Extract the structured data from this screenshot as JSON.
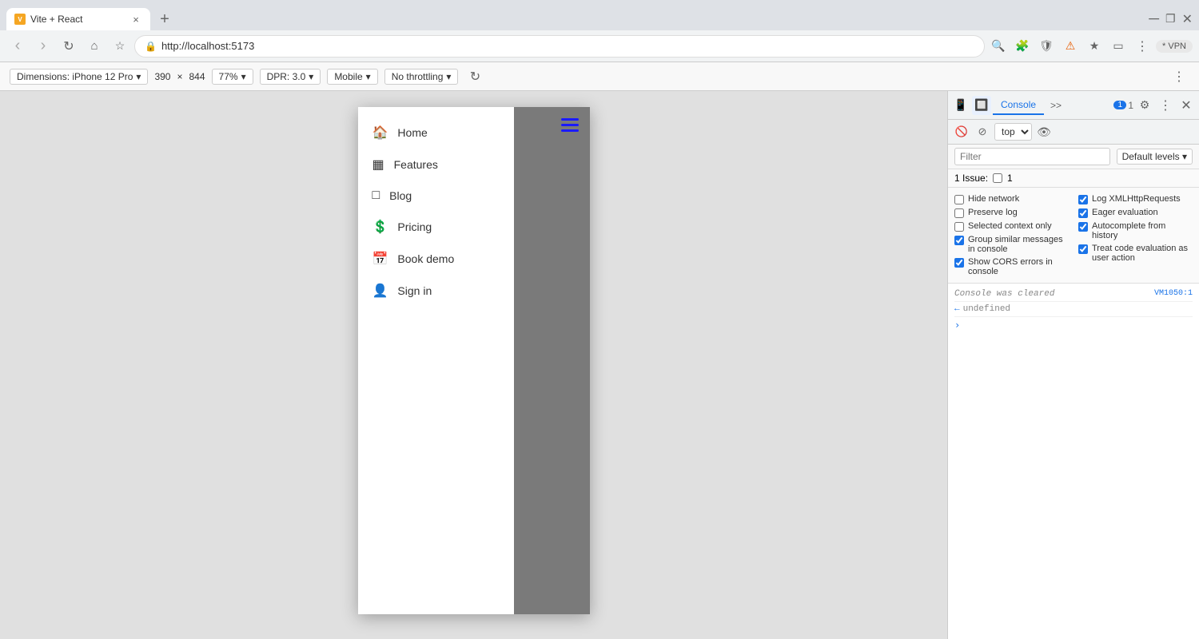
{
  "browser": {
    "tab": {
      "favicon_text": "V",
      "title": "Vite + React"
    },
    "url": "http://localhost:5173",
    "nav_buttons": {
      "back": "‹",
      "forward": "›",
      "reload": "↻",
      "home": "⌂",
      "bookmark": "☆"
    }
  },
  "device_toolbar": {
    "dimensions_label": "Dimensions: iPhone 12 Pro",
    "width": "390",
    "x_label": "×",
    "height": "844",
    "zoom_label": "77%",
    "dpr_label": "DPR: 3.0",
    "mode_label": "Mobile",
    "throttle_label": "No throttling",
    "rotate_icon": "↻"
  },
  "mobile_nav": {
    "items": [
      {
        "id": "home",
        "icon": "🏠",
        "label": "Home"
      },
      {
        "id": "features",
        "icon": "▦",
        "label": "Features"
      },
      {
        "id": "blog",
        "icon": "□",
        "label": "Blog"
      },
      {
        "id": "pricing",
        "icon": "💲",
        "label": "Pricing"
      },
      {
        "id": "book-demo",
        "icon": "📅",
        "label": "Book demo"
      },
      {
        "id": "sign-in",
        "icon": "👤",
        "label": "Sign in"
      }
    ]
  },
  "devtools": {
    "tabs": [
      "Console",
      ">>"
    ],
    "active_tab": "Console",
    "badge_number": "1",
    "tab_number": "1",
    "toolbar": {
      "context_label": "top",
      "eye_label": "👁"
    },
    "filter": {
      "placeholder": "Filter",
      "default_levels_label": "Default levels ▾"
    },
    "issues": {
      "label": "1 Issue:",
      "count": "1"
    },
    "settings": {
      "left": [
        {
          "id": "hide-network",
          "label": "Hide network",
          "checked": false
        },
        {
          "id": "preserve-log",
          "label": "Preserve log",
          "checked": false
        },
        {
          "id": "selected-context",
          "label": "Selected context only",
          "checked": false
        },
        {
          "id": "group-similar",
          "label": "Group similar messages in console",
          "checked": true
        },
        {
          "id": "show-cors",
          "label": "Show CORS errors in console",
          "checked": true
        }
      ],
      "right": [
        {
          "id": "log-xml",
          "label": "Log XMLHttpRequests",
          "checked": true
        },
        {
          "id": "eager-eval",
          "label": "Eager evaluation",
          "checked": true
        },
        {
          "id": "autocomplete",
          "label": "Autocomplete from history",
          "checked": true
        },
        {
          "id": "treat-code",
          "label": "Treat code evaluation as user action",
          "checked": true
        }
      ]
    },
    "console_lines": [
      {
        "type": "info",
        "text": "Console was cleared",
        "source": "VM1050:1"
      },
      {
        "type": "output",
        "prefix": "←",
        "text": "undefined",
        "source": ""
      },
      {
        "type": "prompt",
        "prefix": ">",
        "text": "",
        "source": ""
      }
    ]
  }
}
